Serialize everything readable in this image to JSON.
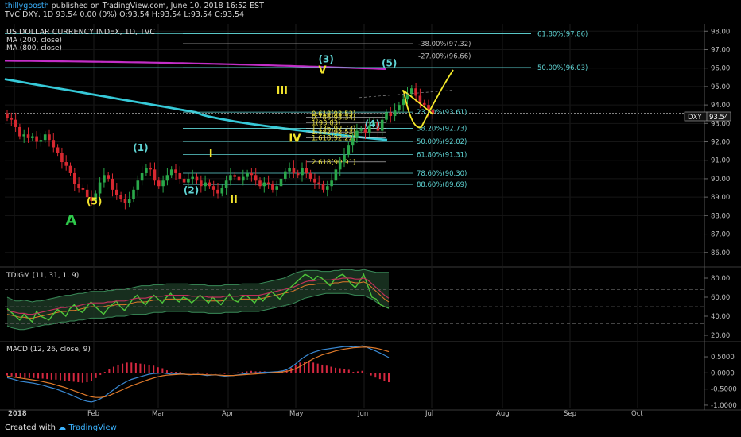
{
  "header": {
    "author": "thillygoosth",
    "published": "published on TradingView.com, June 10, 2018 16:52 EST",
    "symbol_line": "TVC:DXY, 1D  93.54  0.00 (0%)  O:93.54  H:93.54  L:93.54  C:93.54"
  },
  "main": {
    "title": "US DOLLAR CURRENCY INDEX, 1D, TVC",
    "studies": [
      "MA (200, close)",
      "MA (800, close)"
    ],
    "price_tag": {
      "symbol": "DXY",
      "value": "93.54"
    }
  },
  "colors": {
    "bull": "#2aa84a",
    "bear": "#d62830",
    "ma200": "#c22ec7",
    "ma800": "#36c9d8",
    "fib": "#5fd4d4",
    "fib_inner": "#e8e040",
    "wave_yellow": "#f2e42c",
    "wave_cyan": "#5fd4d4",
    "wave_green": "#2ec84a",
    "projection": "#f5ea2a",
    "tdi_green": "#4ec63a",
    "tdi_red": "#c0305a",
    "tdi_band": "#3a8a58",
    "macd_line": "#3a8ad4",
    "signal_line": "#e07a2a",
    "hist": "#d62840"
  },
  "chart_data": [
    {
      "type": "line",
      "name": "price",
      "x_labels": [
        "2018",
        "Feb",
        "Mar",
        "Apr",
        "May",
        "Jun",
        "Jul",
        "Aug",
        "Sep",
        "Oct"
      ],
      "y_ticks": [
        86.0,
        87.0,
        88.0,
        89.0,
        90.0,
        91.0,
        92.0,
        93.0,
        94.0,
        95.0,
        96.0,
        97.0,
        98.0
      ],
      "ylim": [
        85.3,
        98.4
      ],
      "candles_close": [
        93.3,
        93.2,
        92.8,
        92.3,
        92.4,
        92.2,
        92.3,
        92.0,
        92.1,
        92.4,
        92.1,
        91.7,
        91.4,
        90.9,
        90.7,
        90.3,
        89.7,
        89.5,
        89.4,
        89.0,
        88.8,
        89.2,
        89.8,
        90.2,
        90.0,
        89.4,
        89.1,
        88.9,
        88.7,
        88.9,
        89.4,
        89.9,
        90.3,
        90.6,
        90.5,
        89.9,
        89.6,
        89.9,
        90.2,
        90.5,
        90.3,
        90.0,
        89.8,
        90.0,
        90.1,
        89.9,
        89.6,
        89.8,
        89.6,
        89.4,
        89.2,
        89.5,
        89.9,
        90.2,
        90.1,
        89.9,
        90.1,
        90.3,
        90.2,
        89.9,
        89.6,
        89.8,
        89.7,
        89.4,
        89.6,
        90.0,
        90.4,
        90.6,
        90.3,
        90.2,
        90.6,
        90.3,
        90.0,
        89.8,
        89.7,
        89.4,
        89.6,
        89.9,
        90.5,
        90.9,
        91.3,
        91.8,
        92.2,
        92.6,
        92.7,
        92.5,
        92.9,
        93.1,
        92.6,
        93.2,
        93.6,
        93.4,
        93.7,
        94.0,
        94.3,
        94.6,
        94.9,
        94.5,
        94.1,
        94.0,
        93.7,
        93.5
      ],
      "ma200": {
        "start": 95.4,
        "mid": 93.6,
        "end": 92.1
      },
      "ma800": {
        "start": 96.4,
        "end": 95.95
      },
      "price_line": 93.54,
      "fib_outer": [
        {
          "label": "61.80%(97.86)",
          "value": 97.86
        },
        {
          "label": "-38.00%(97.32)",
          "value": 97.32
        },
        {
          "label": "-27.00%(96.66)",
          "value": 96.66
        },
        {
          "label": "50.00%(96.03)",
          "value": 96.03
        },
        {
          "label": "23.60%(93.61)",
          "value": 93.61
        },
        {
          "label": "38.20%(92.73)",
          "value": 92.73
        },
        {
          "label": "50.00%(92.02)",
          "value": 92.02
        },
        {
          "label": "61.80%(91.31)",
          "value": 91.31
        },
        {
          "label": "78.60%(90.30)",
          "value": 90.3
        },
        {
          "label": "88.60%(89.69)",
          "value": 89.69
        }
      ],
      "fib_inner": [
        {
          "label": "0.618(93.53)",
          "value": 93.53
        },
        {
          "label": "0.786(93.34)",
          "value": 93.34
        },
        {
          "label": "1(93.03)",
          "value": 93.03
        },
        {
          "label": "1.236(92.73)",
          "value": 92.73
        },
        {
          "label": "1.382(92.53)",
          "value": 92.53
        },
        {
          "label": "1.618(92.22)",
          "value": 92.22
        },
        {
          "label": "2.618(90.91)",
          "value": 90.91
        }
      ],
      "wave_labels": [
        {
          "text": "A",
          "value": 87.5,
          "i": 15
        },
        {
          "text": "(5)",
          "value": 88.6,
          "i": 20
        },
        {
          "text": "(1)",
          "value": 91.5,
          "i": 31
        },
        {
          "text": "(2)",
          "value": 89.2,
          "i": 43
        },
        {
          "text": "I",
          "value": 91.2,
          "i": 49
        },
        {
          "text": "II",
          "value": 88.7,
          "i": 54
        },
        {
          "text": "III",
          "value": 94.6,
          "i": 65
        },
        {
          "text": "IV",
          "value": 92.0,
          "i": 68
        },
        {
          "text": "(3)",
          "value": 96.3,
          "i": 75
        },
        {
          "text": "V",
          "value": 95.7,
          "i": 75
        },
        {
          "text": "(4)",
          "value": 92.8,
          "i": 86
        },
        {
          "text": "(5)",
          "value": 96.1,
          "i": 90
        }
      ],
      "projection": [
        93.5,
        94.7,
        92.8,
        95.9
      ]
    },
    {
      "type": "line",
      "name": "TDIGM",
      "title": "TDIGM (11, 31, 1, 9)",
      "y_ticks": [
        20.0,
        40.0,
        60.0,
        80.0
      ],
      "ylim": [
        15,
        90
      ],
      "levels": [
        68,
        50,
        32
      ],
      "rsi": [
        48,
        44,
        40,
        36,
        42,
        38,
        34,
        45,
        40,
        38,
        36,
        42,
        47,
        44,
        40,
        48,
        52,
        46,
        44,
        50,
        55,
        50,
        46,
        42,
        48,
        52,
        56,
        50,
        46,
        52,
        58,
        62,
        56,
        52,
        58,
        62,
        58,
        54,
        60,
        64,
        58,
        55,
        60,
        58,
        54,
        58,
        62,
        58,
        54,
        60,
        56,
        52,
        58,
        63,
        57,
        55,
        60,
        62,
        58,
        54,
        60,
        56,
        62,
        66,
        62,
        58,
        64,
        68,
        72,
        76,
        80,
        84,
        82,
        78,
        82,
        80,
        76,
        72,
        78,
        82,
        84,
        80,
        74,
        70,
        76,
        84,
        72,
        60,
        58,
        52,
        50,
        49
      ],
      "signal": [
        42,
        41,
        40,
        39,
        39,
        38,
        38,
        39,
        40,
        41,
        42,
        43,
        44,
        45,
        45,
        46,
        46,
        47,
        48,
        49,
        50,
        50,
        50,
        50,
        51,
        51,
        52,
        52,
        52,
        53,
        54,
        55,
        55,
        55,
        56,
        57,
        57,
        57,
        58,
        58,
        58,
        58,
        58,
        58,
        57,
        57,
        57,
        57,
        56,
        56,
        56,
        56,
        57,
        57,
        57,
        57,
        58,
        58,
        58,
        58,
        58,
        59,
        60,
        61,
        62,
        63,
        64,
        65,
        66,
        68,
        70,
        72,
        73,
        73,
        74,
        74,
        74,
        74,
        75,
        75,
        76,
        76,
        76,
        75,
        75,
        76,
        74,
        70,
        66,
        62,
        58,
        55
      ],
      "upper": [
        60,
        58,
        56,
        56,
        57,
        56,
        55,
        56,
        56,
        57,
        58,
        59,
        60,
        61,
        62,
        62,
        63,
        64,
        64,
        65,
        66,
        66,
        66,
        66,
        67,
        67,
        68,
        68,
        68,
        69,
        70,
        71,
        72,
        72,
        72,
        73,
        73,
        73,
        74,
        74,
        74,
        74,
        74,
        74,
        73,
        73,
        73,
        73,
        72,
        72,
        72,
        72,
        73,
        73,
        73,
        73,
        74,
        74,
        74,
        74,
        74,
        75,
        76,
        77,
        78,
        79,
        80,
        82,
        84,
        86,
        87,
        88,
        88,
        88,
        88,
        87,
        87,
        87,
        88,
        88,
        89,
        89,
        89,
        88,
        88,
        89,
        88,
        87,
        86,
        86,
        86,
        86
      ],
      "lower": [
        30,
        28,
        27,
        26,
        26,
        27,
        28,
        29,
        30,
        31,
        31,
        32,
        33,
        34,
        34,
        35,
        35,
        36,
        36,
        37,
        38,
        38,
        38,
        38,
        39,
        39,
        40,
        40,
        40,
        41,
        42,
        42,
        42,
        42,
        43,
        44,
        44,
        44,
        45,
        45,
        45,
        45,
        45,
        45,
        44,
        44,
        44,
        44,
        43,
        43,
        43,
        43,
        44,
        44,
        44,
        44,
        45,
        45,
        45,
        45,
        45,
        46,
        47,
        48,
        49,
        50,
        51,
        52,
        53,
        55,
        57,
        59,
        60,
        61,
        62,
        63,
        64,
        64,
        64,
        64,
        64,
        64,
        63,
        62,
        62,
        62,
        60,
        58,
        55,
        52,
        50,
        48
      ]
    },
    {
      "type": "line",
      "name": "MACD",
      "title": "MACD (12, 26, close, 9)",
      "y_ticks": [
        -1.0,
        -0.5,
        0.0,
        0.5
      ],
      "ylim": [
        -1.1,
        0.92
      ],
      "macd": [
        -0.15,
        -0.18,
        -0.22,
        -0.26,
        -0.28,
        -0.3,
        -0.32,
        -0.35,
        -0.38,
        -0.42,
        -0.46,
        -0.5,
        -0.55,
        -0.6,
        -0.66,
        -0.72,
        -0.78,
        -0.84,
        -0.88,
        -0.9,
        -0.86,
        -0.8,
        -0.72,
        -0.62,
        -0.52,
        -0.42,
        -0.34,
        -0.26,
        -0.2,
        -0.16,
        -0.12,
        -0.08,
        -0.04,
        -0.02,
        -0.01,
        0.0,
        -0.02,
        -0.04,
        -0.03,
        -0.02,
        -0.04,
        -0.06,
        -0.05,
        -0.04,
        -0.06,
        -0.08,
        -0.07,
        -0.06,
        -0.08,
        -0.1,
        -0.09,
        -0.08,
        -0.06,
        -0.04,
        -0.02,
        0.0,
        0.0,
        0.01,
        0.02,
        0.02,
        0.03,
        0.04,
        0.06,
        0.1,
        0.18,
        0.28,
        0.4,
        0.5,
        0.58,
        0.64,
        0.68,
        0.72,
        0.74,
        0.76,
        0.78,
        0.8,
        0.82,
        0.82,
        0.8,
        0.82,
        0.84,
        0.8,
        0.74,
        0.68,
        0.62,
        0.55,
        0.48
      ],
      "signal": [
        -0.1,
        -0.12,
        -0.14,
        -0.16,
        -0.18,
        -0.2,
        -0.22,
        -0.24,
        -0.27,
        -0.3,
        -0.33,
        -0.37,
        -0.41,
        -0.45,
        -0.5,
        -0.55,
        -0.6,
        -0.65,
        -0.7,
        -0.74,
        -0.76,
        -0.76,
        -0.74,
        -0.7,
        -0.64,
        -0.58,
        -0.52,
        -0.46,
        -0.4,
        -0.35,
        -0.3,
        -0.25,
        -0.2,
        -0.16,
        -0.12,
        -0.09,
        -0.07,
        -0.06,
        -0.05,
        -0.04,
        -0.04,
        -0.05,
        -0.05,
        -0.05,
        -0.05,
        -0.06,
        -0.06,
        -0.06,
        -0.07,
        -0.08,
        -0.08,
        -0.08,
        -0.07,
        -0.06,
        -0.05,
        -0.04,
        -0.03,
        -0.02,
        -0.01,
        0.0,
        0.01,
        0.02,
        0.03,
        0.05,
        0.08,
        0.13,
        0.2,
        0.28,
        0.36,
        0.44,
        0.5,
        0.56,
        0.6,
        0.64,
        0.68,
        0.71,
        0.74,
        0.76,
        0.78,
        0.79,
        0.8,
        0.8,
        0.79,
        0.77,
        0.74,
        0.7,
        0.66
      ]
    }
  ],
  "footer": {
    "created_with": "Created with",
    "brand": "TradingView"
  }
}
